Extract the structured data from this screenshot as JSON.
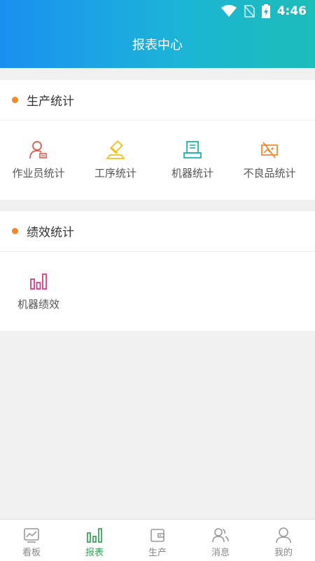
{
  "status": {
    "time": "4:46",
    "icons": [
      "wifi-icon",
      "no-sim-icon",
      "battery-charging-icon"
    ]
  },
  "header": {
    "title": "报表中心"
  },
  "sections": [
    {
      "title": "生产统计",
      "items": [
        {
          "label": "作业员统计",
          "icon": "operator-icon",
          "color": "#e25a4a"
        },
        {
          "label": "工序统计",
          "icon": "process-icon",
          "color": "#f0c020"
        },
        {
          "label": "机器统计",
          "icon": "machine-icon",
          "color": "#1db5b0"
        },
        {
          "label": "不良品统计",
          "icon": "defect-icon",
          "color": "#f08a2c"
        }
      ]
    },
    {
      "title": "绩效统计",
      "items": [
        {
          "label": "机器绩效",
          "icon": "bar-chart-icon",
          "color": "#d63d8c"
        }
      ]
    }
  ],
  "nav": [
    {
      "label": "看板",
      "icon": "dashboard-icon",
      "active": false
    },
    {
      "label": "报表",
      "icon": "report-icon",
      "active": true
    },
    {
      "label": "生产",
      "icon": "production-icon",
      "active": false
    },
    {
      "label": "消息",
      "icon": "message-icon",
      "active": false
    },
    {
      "label": "我的",
      "icon": "profile-icon",
      "active": false
    }
  ],
  "colors": {
    "accent_dot": "#f08a2c",
    "nav_active": "#3aa55a",
    "nav_inactive": "#888888"
  }
}
